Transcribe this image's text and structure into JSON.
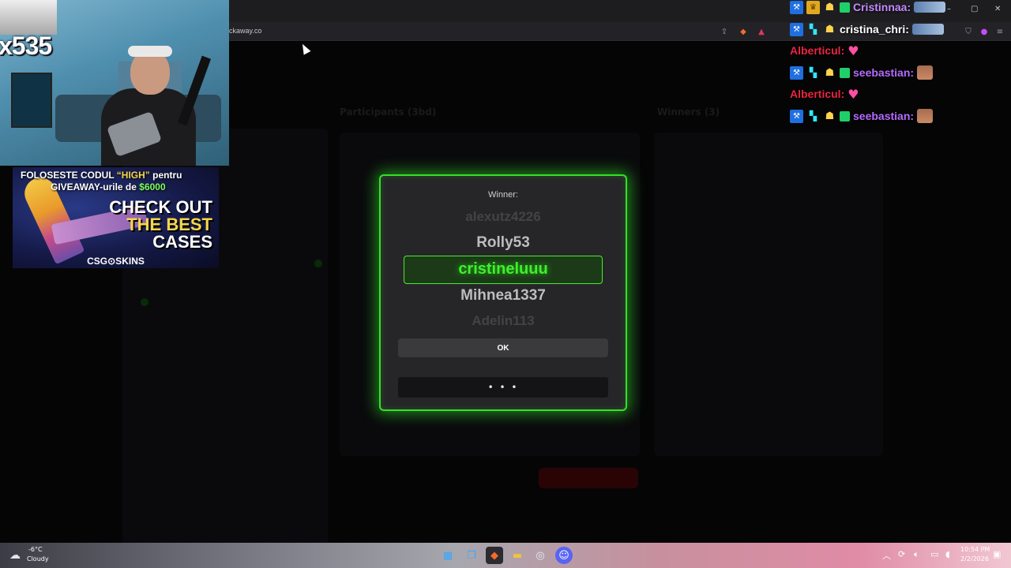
{
  "browser": {
    "url": "ckaway.co",
    "window_controls": [
      "–",
      "▢",
      "✕"
    ]
  },
  "background_page": {
    "left_title": "Participants (3bd)",
    "right_title": "Winners (3)"
  },
  "modal": {
    "winner_label": "Winner:",
    "names": [
      "alexutz4226",
      "Rolly53",
      "cristineluuu",
      "Mihnea1337",
      "Adelin113"
    ],
    "winner": "cristineluuu",
    "ok_label": "OK",
    "dots_label": "• • •",
    "accent_color": "#35e02a"
  },
  "webcam": {
    "multiplier": "x535"
  },
  "ad": {
    "line1_prefix": "FOLOSESTE CODUL ",
    "line1_code": "“HIGH”",
    "line1_suffix": " pentru",
    "line2_prefix": "GIVEAWAY-urile de ",
    "line2_amount": "$6000",
    "big1": "CHECK OUT",
    "big2": "THE BEST",
    "big3": "CASES",
    "brand": "CSG⊙SKINS"
  },
  "chat": [
    {
      "name": "Cristinnaa:",
      "color": "#c58bff",
      "badges": [
        "blue",
        "crown",
        "robot",
        "gift"
      ],
      "emote": "blur"
    },
    {
      "name": "cristina_chri:",
      "color": "#ffffff",
      "badges": [
        "blue",
        "cyan",
        "robot"
      ],
      "emote": "blur"
    },
    {
      "name": "Alberticul:",
      "color": "#e8253f",
      "badges": [],
      "emote": "heart"
    },
    {
      "name": "seebastian:",
      "color": "#b56bff",
      "badges": [
        "blue",
        "cyan",
        "robot",
        "gift"
      ],
      "emote": "face"
    },
    {
      "name": "Alberticul:",
      "color": "#e8253f",
      "badges": [],
      "emote": "heart"
    },
    {
      "name": "seebastian:",
      "color": "#b56bff",
      "badges": [
        "blue",
        "cyan",
        "robot",
        "gift"
      ],
      "emote": "face"
    }
  ],
  "taskbar": {
    "temperature": "-6°C",
    "weather": "Cloudy",
    "time": "10:54 PM",
    "date": "2/2/2026"
  }
}
